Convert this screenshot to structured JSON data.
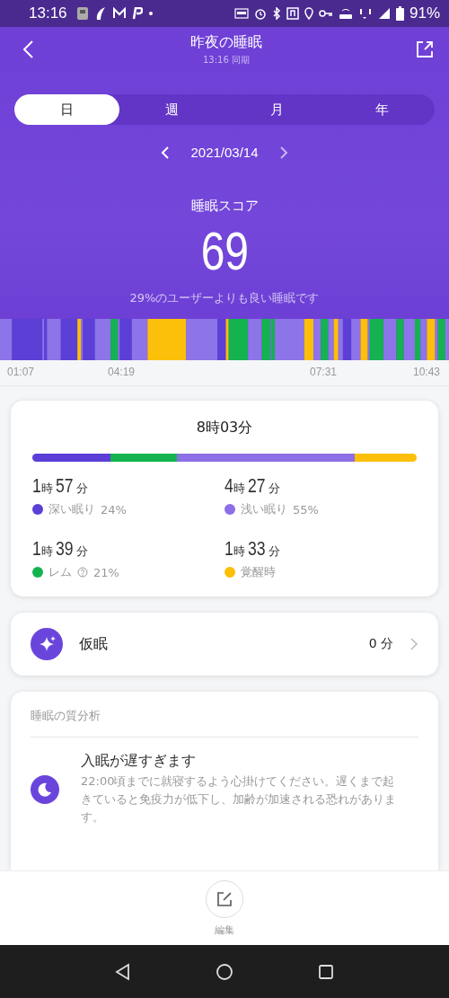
{
  "status_bar": {
    "time": "13:16",
    "battery": "91%"
  },
  "header": {
    "title": "昨夜の睡眠",
    "subtitle": "13:16 同期"
  },
  "tabs": [
    {
      "label": "日",
      "selected": true
    },
    {
      "label": "週",
      "selected": false
    },
    {
      "label": "月",
      "selected": false
    },
    {
      "label": "年",
      "selected": false
    }
  ],
  "date": "2021/03/14",
  "score": {
    "label": "睡眠スコア",
    "value": "69",
    "caption": "29%のユーザーよりも良い睡眠です"
  },
  "timeline": {
    "times": [
      "01:07",
      "04:19",
      "07:31",
      "10:43"
    ]
  },
  "summary": {
    "total": "8時03分",
    "stages": [
      {
        "hours": "1",
        "hour_unit": "時",
        "minutes": "57",
        "minute_unit": "分",
        "label": "深い眠り",
        "percent": "24%",
        "color": "#5b3fd6",
        "help": false
      },
      {
        "hours": "4",
        "hour_unit": "時",
        "minutes": "27",
        "minute_unit": "分",
        "label": "浅い眠り",
        "percent": "55%",
        "color": "#8d6fe6",
        "help": false
      },
      {
        "hours": "1",
        "hour_unit": "時",
        "minutes": "39",
        "minute_unit": "分",
        "label": "レム",
        "percent": "21%",
        "color": "#14b350",
        "help": true
      },
      {
        "hours": "1",
        "hour_unit": "時",
        "minutes": "33",
        "minute_unit": "分",
        "label": "覚醒時",
        "color": "#fcbf0a",
        "help": false
      }
    ]
  },
  "nap": {
    "label": "仮眠",
    "value": "0 分"
  },
  "analysis": {
    "title": "睡眠の質分析",
    "items": [
      {
        "heading": "入眠が遅すぎます",
        "text": "22:00頃までに就寝するよう心掛けてください。遅くまで起きていると免疫力が低下し、加齢が加速される恐れがあります。"
      }
    ]
  },
  "bottom": {
    "edit_label": "編集"
  }
}
